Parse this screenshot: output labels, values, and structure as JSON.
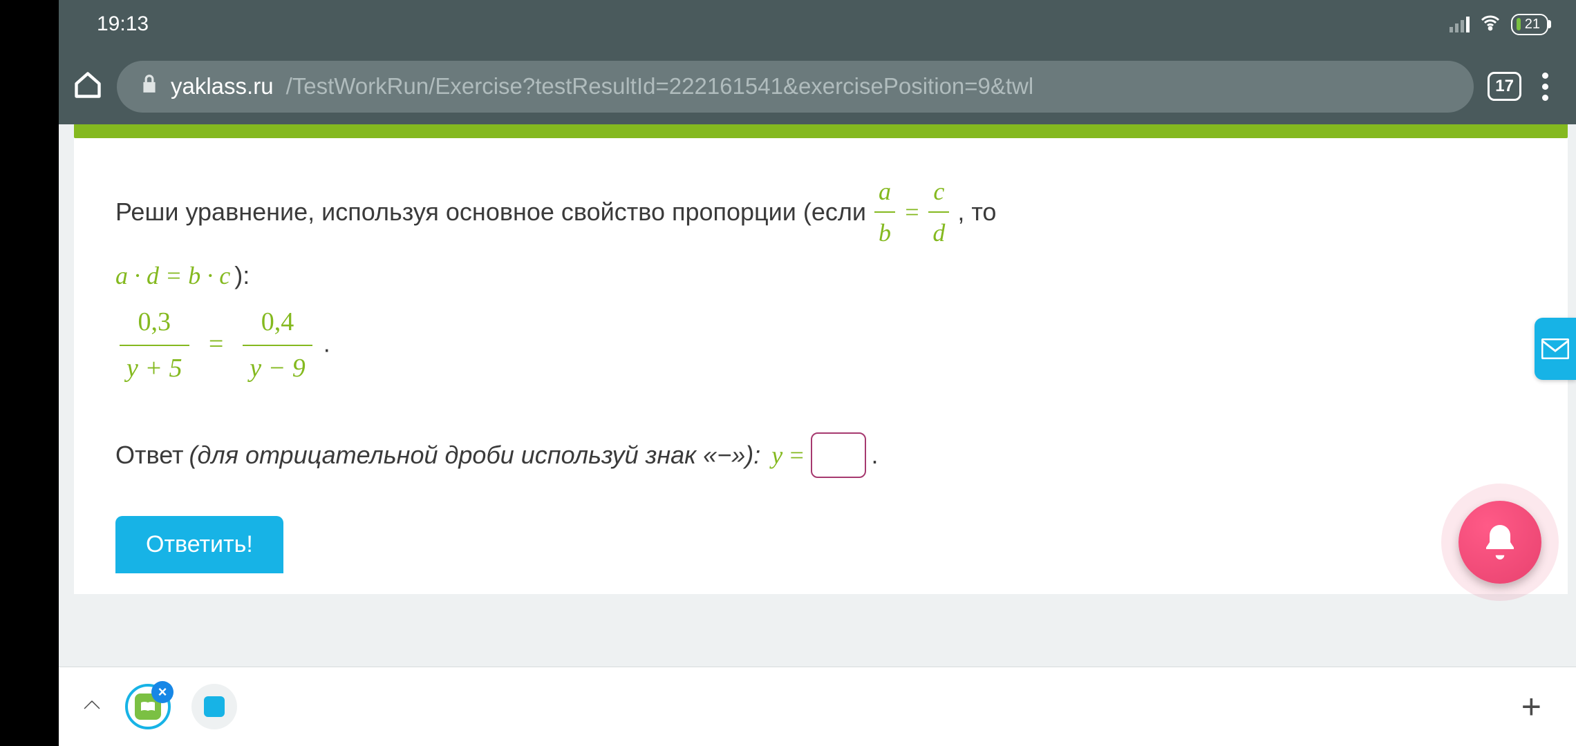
{
  "status": {
    "time": "19:13",
    "battery_percent": "21"
  },
  "browser": {
    "url_domain": "yaklass.ru",
    "url_path": "/TestWorkRun/Exercise?testResultId=222161541&exercisePosition=9&twl",
    "tab_count": "17"
  },
  "problem": {
    "intro_part1": "Реши уравнение, используя основное свойство пропорции (если",
    "frac1_num": "a",
    "frac1_den": "b",
    "eq": "=",
    "frac2_num": "c",
    "frac2_den": "d",
    "intro_part2": ", то",
    "rule": "a · d = b · c",
    "rule_close": "):",
    "lhs_num": "0,3",
    "lhs_den": "y + 5",
    "rhs_num": "0,4",
    "rhs_den": "y − 9",
    "dot": "."
  },
  "answer": {
    "label": "Ответ ",
    "hint": "(для отрицательной дроби используй знак «−»):",
    "var": "y",
    "eq": "=",
    "after": "."
  },
  "submit_label": "Ответить!"
}
